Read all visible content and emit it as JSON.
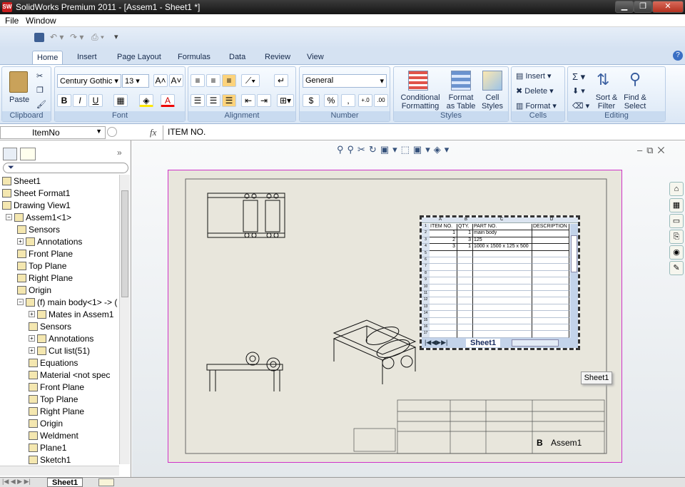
{
  "window": {
    "title": "SolidWorks Premium 2011 - [Assem1 - Sheet1 *]",
    "logo": "SW",
    "minimize": "▁",
    "restore": "❐",
    "close": "✕"
  },
  "menu": [
    "File",
    "Window"
  ],
  "ribbon": {
    "tabs": [
      "Home",
      "Insert",
      "Page Layout",
      "Formulas",
      "Data",
      "Review",
      "View"
    ],
    "active_tab": "Home",
    "clipboard": {
      "label": "Clipboard",
      "paste": "Paste"
    },
    "font": {
      "label": "Font",
      "family": "Century Gothic",
      "size": "13",
      "bold": "B",
      "italic": "I",
      "underline": "U"
    },
    "alignment": {
      "label": "Alignment"
    },
    "number": {
      "label": "Number",
      "format": "General",
      "currency": "$",
      "percent": "%",
      "comma": ","
    },
    "styles": {
      "label": "Styles",
      "conditional": "Conditional Formatting",
      "as_table": "Format as Table",
      "cell_styles": "Cell Styles"
    },
    "cells": {
      "label": "Cells",
      "insert": "Insert",
      "delete": "Delete",
      "format": "Format"
    },
    "editing": {
      "label": "Editing",
      "sort": "Sort & Filter",
      "find": "Find & Select"
    }
  },
  "formula_bar": {
    "name_box": "ItemNo",
    "fx": "fx",
    "value": "ITEM NO."
  },
  "feature_tree": [
    {
      "label": "Sheet1",
      "icon": "sheet-icon",
      "indent": 0
    },
    {
      "label": "Sheet Format1",
      "icon": "sheet-format-icon",
      "indent": 0
    },
    {
      "label": "Drawing View1",
      "icon": "drawing-view-icon",
      "indent": 0
    },
    {
      "label": "Assem1<1>",
      "icon": "assembly-icon",
      "indent": 1
    },
    {
      "label": "Sensors",
      "icon": "sensor-icon",
      "indent": 2
    },
    {
      "label": "Annotations",
      "icon": "annotation-icon",
      "indent": 2
    },
    {
      "label": "Front Plane",
      "icon": "plane-icon",
      "indent": 2
    },
    {
      "label": "Top Plane",
      "icon": "plane-icon",
      "indent": 2
    },
    {
      "label": "Right Plane",
      "icon": "plane-icon",
      "indent": 2
    },
    {
      "label": "Origin",
      "icon": "origin-icon",
      "indent": 2
    },
    {
      "label": "(f) main body<1> -> (",
      "icon": "part-icon",
      "indent": 2
    },
    {
      "label": "Mates in Assem1",
      "icon": "mates-icon",
      "indent": 3
    },
    {
      "label": "Sensors",
      "icon": "sensor-icon",
      "indent": 3
    },
    {
      "label": "Annotations",
      "icon": "annotation-icon",
      "indent": 3
    },
    {
      "label": "Cut list(51)",
      "icon": "cut-list-icon",
      "indent": 3
    },
    {
      "label": "Equations",
      "icon": "equation-icon",
      "indent": 3
    },
    {
      "label": "Material <not spec",
      "icon": "material-icon",
      "indent": 3
    },
    {
      "label": "Front Plane",
      "icon": "plane-icon",
      "indent": 3
    },
    {
      "label": "Top Plane",
      "icon": "plane-icon",
      "indent": 3
    },
    {
      "label": "Right Plane",
      "icon": "plane-icon",
      "indent": 3
    },
    {
      "label": "Origin",
      "icon": "origin-icon",
      "indent": 3
    },
    {
      "label": "Weldment",
      "icon": "weldment-icon",
      "indent": 3
    },
    {
      "label": "Plane1",
      "icon": "plane-icon",
      "indent": 3
    },
    {
      "label": "Sketch1",
      "icon": "sketch-icon",
      "indent": 3
    }
  ],
  "bom": {
    "col_letters": [
      "A",
      "B",
      "C",
      "D"
    ],
    "headers": [
      "ITEM NO.",
      "QTY.",
      "PART NO.",
      "DESCRIPTION"
    ],
    "rows": [
      [
        "1",
        "1",
        "main body",
        ""
      ],
      [
        "2",
        "3",
        "125",
        ""
      ],
      [
        "3",
        "1",
        "1000 x 1500 x 125 x 500",
        ""
      ]
    ],
    "row_numbers": [
      "1",
      "2",
      "3",
      "4",
      "5",
      "6",
      "7",
      "8",
      "9",
      "10",
      "11",
      "12",
      "13",
      "14",
      "15",
      "16",
      "17"
    ],
    "sheet_tab": "Sheet1"
  },
  "tooltip": "Sheet1",
  "title_block": {
    "size": "B",
    "name": "Assem1"
  },
  "status": {
    "sheet_tab": "Sheet1"
  },
  "colors": {
    "sheet_border": "#d033c8",
    "ribbon": "#dbe7f5",
    "title_bg": "#151515"
  }
}
